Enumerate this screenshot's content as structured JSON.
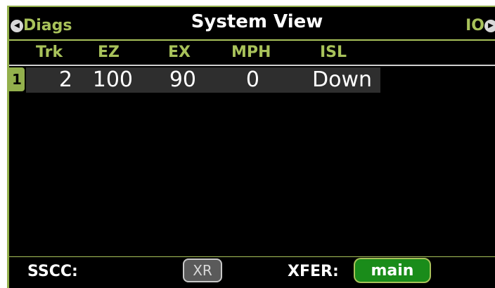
{
  "header": {
    "left_label": "Diags",
    "title": "System View",
    "right_label": "IO"
  },
  "columns": [
    "Trk",
    "EZ",
    "EX",
    "MPH",
    "ISL"
  ],
  "rows": [
    {
      "index": "1",
      "trk": "2",
      "ez": "100",
      "ex": "90",
      "mph": "0",
      "isl": "Down"
    }
  ],
  "footer": {
    "sscc_label": "SSCC:",
    "xr_label": "XR",
    "xfer_label": "XFER:",
    "main_label": "main"
  },
  "colors": {
    "accent": "#a8c25a",
    "active_button": "#1a8c1a",
    "background": "#000000"
  }
}
